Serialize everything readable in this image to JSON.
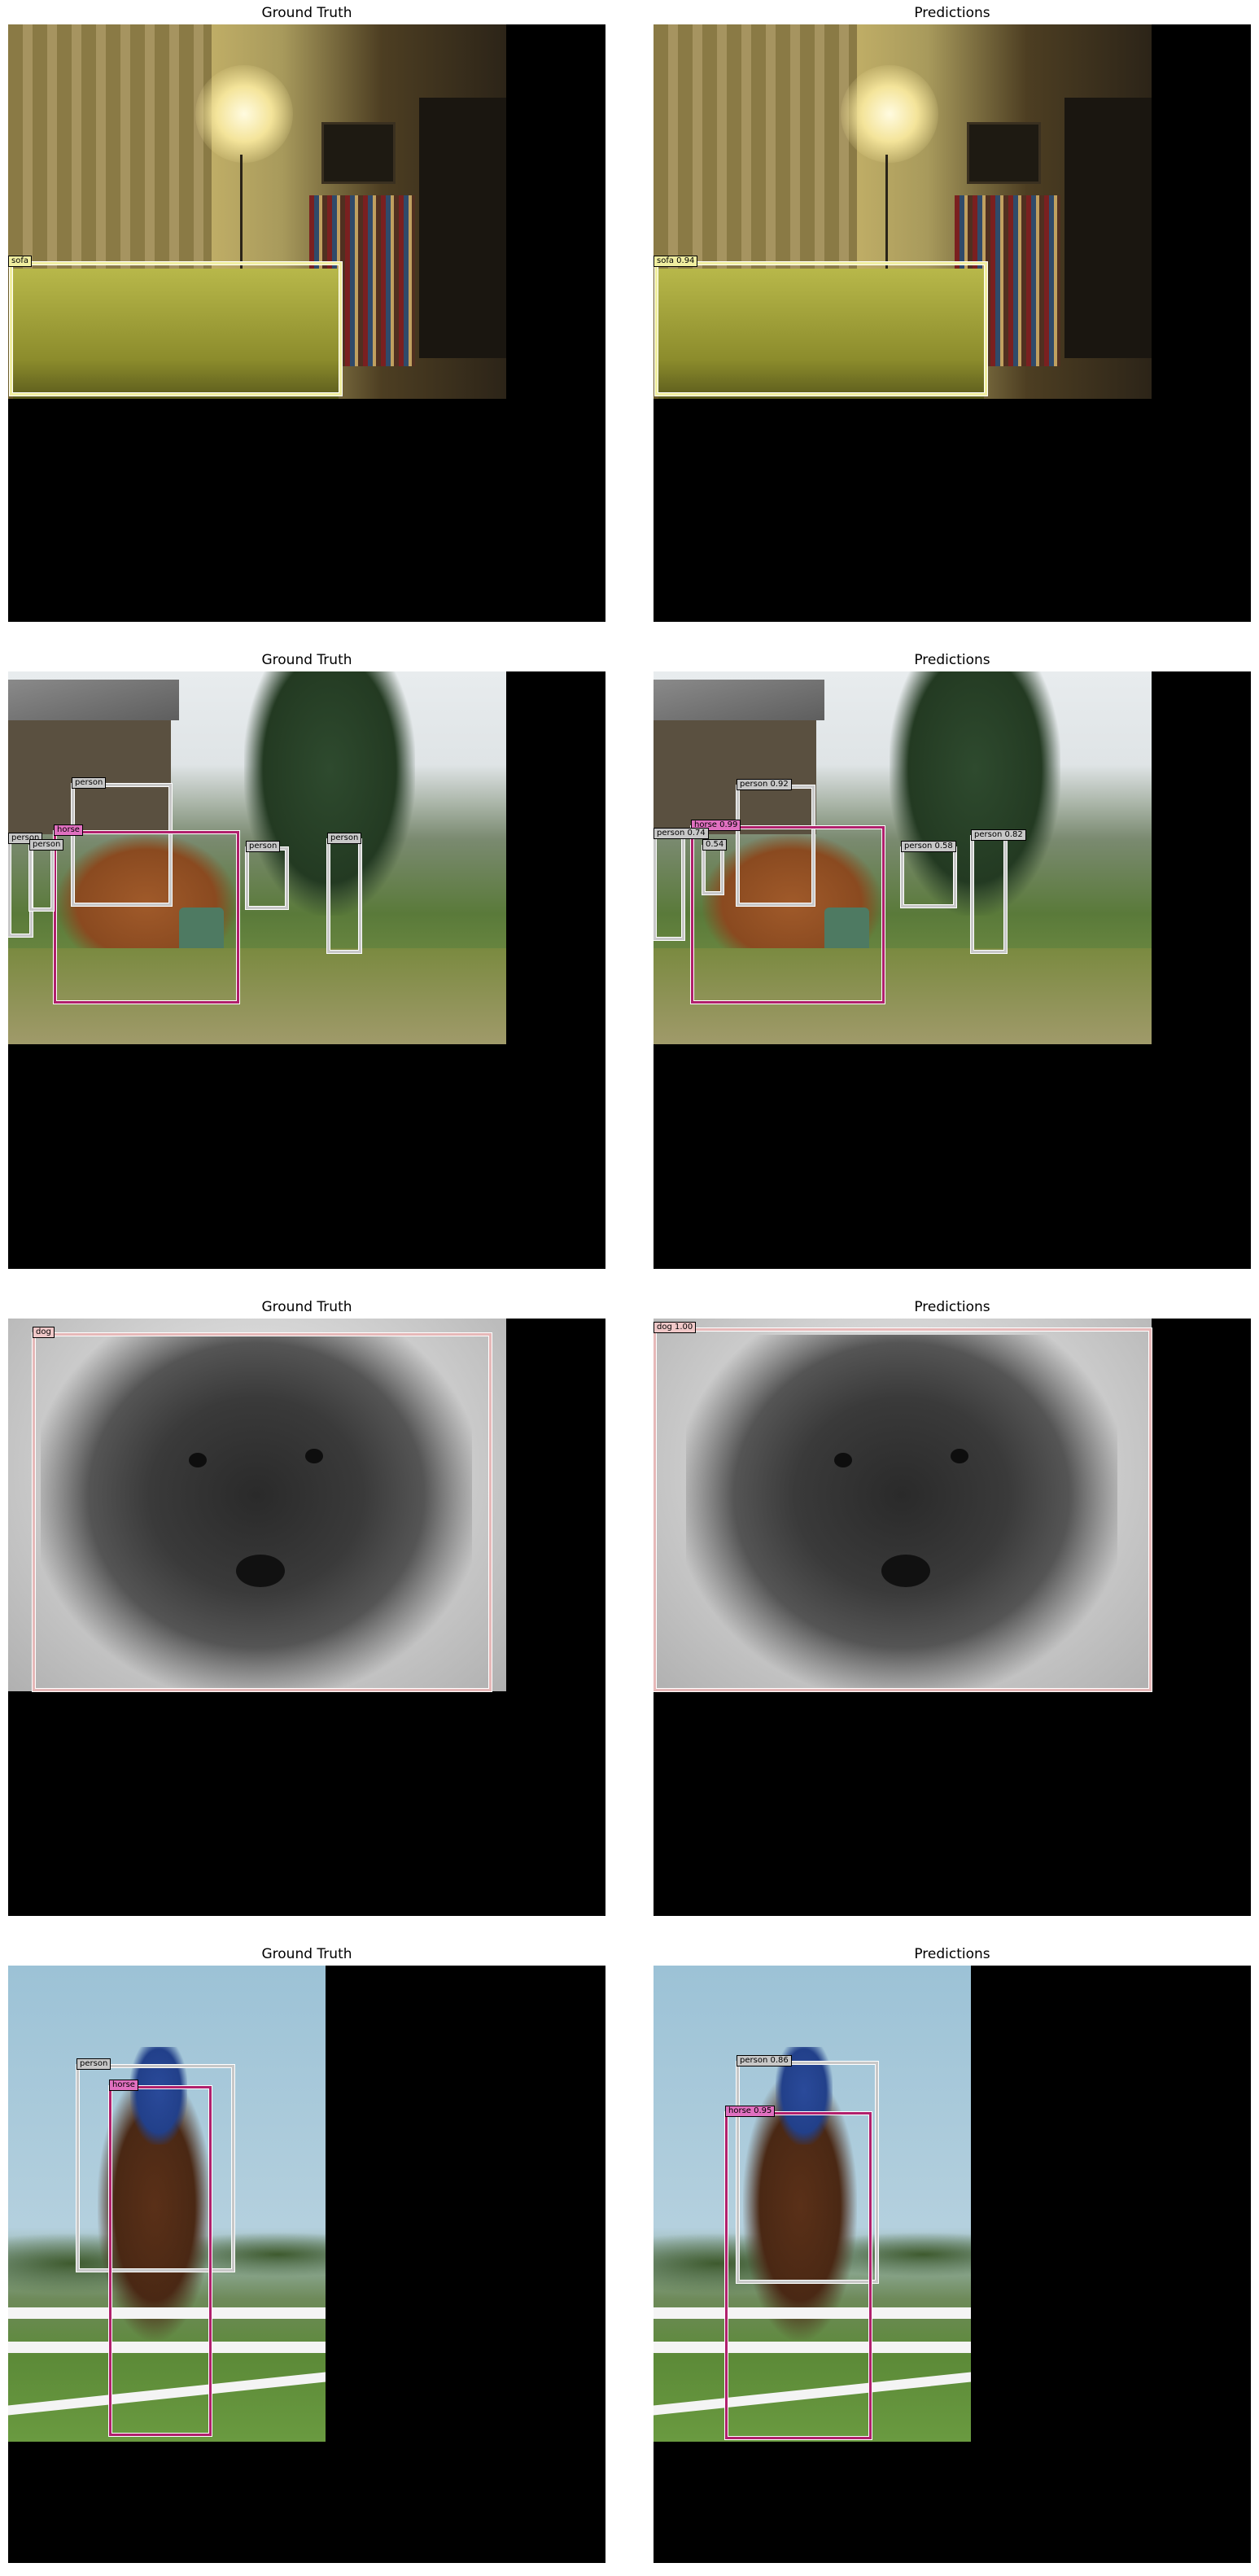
{
  "titles": {
    "left": "Ground Truth",
    "right": "Predictions"
  },
  "colors": {
    "sofa": "#f0eea0",
    "person": "#c8c8c8",
    "horse": "#e070c0",
    "dog": "#f0c8c8"
  },
  "rows": [
    {
      "scene": "living-room",
      "ground_truth": [
        {
          "label": "sofa",
          "text": "sofa"
        }
      ],
      "predictions": [
        {
          "label": "sofa",
          "text": "sofa 0.94",
          "score": 0.94
        }
      ]
    },
    {
      "scene": "farm-horse",
      "ground_truth": [
        {
          "label": "person",
          "text": "person"
        },
        {
          "label": "horse",
          "text": "horse"
        },
        {
          "label": "person",
          "text": "person"
        },
        {
          "label": "person",
          "text": "person"
        },
        {
          "label": "person",
          "text": "person"
        },
        {
          "label": "person",
          "text": "person"
        }
      ],
      "predictions": [
        {
          "label": "person",
          "text": "person 0.92",
          "score": 0.92
        },
        {
          "label": "horse",
          "text": "horse 0.99",
          "score": 0.99
        },
        {
          "label": "person",
          "text": "person 0.74",
          "score": 0.74
        },
        {
          "label": "person",
          "text": "0.54",
          "score": 0.54
        },
        {
          "label": "person",
          "text": "person 0.58",
          "score": 0.58
        },
        {
          "label": "person",
          "text": "person 0.82",
          "score": 0.82
        }
      ]
    },
    {
      "scene": "dog-portrait",
      "ground_truth": [
        {
          "label": "dog",
          "text": "dog"
        }
      ],
      "predictions": [
        {
          "label": "dog",
          "text": "dog 1.00",
          "score": 1.0
        }
      ]
    },
    {
      "scene": "show-jumping",
      "ground_truth": [
        {
          "label": "person",
          "text": "person"
        },
        {
          "label": "horse",
          "text": "horse"
        }
      ],
      "predictions": [
        {
          "label": "person",
          "text": "person 0.86",
          "score": 0.86
        },
        {
          "label": "horse",
          "text": "horse 0.95",
          "score": 0.95
        }
      ]
    }
  ]
}
